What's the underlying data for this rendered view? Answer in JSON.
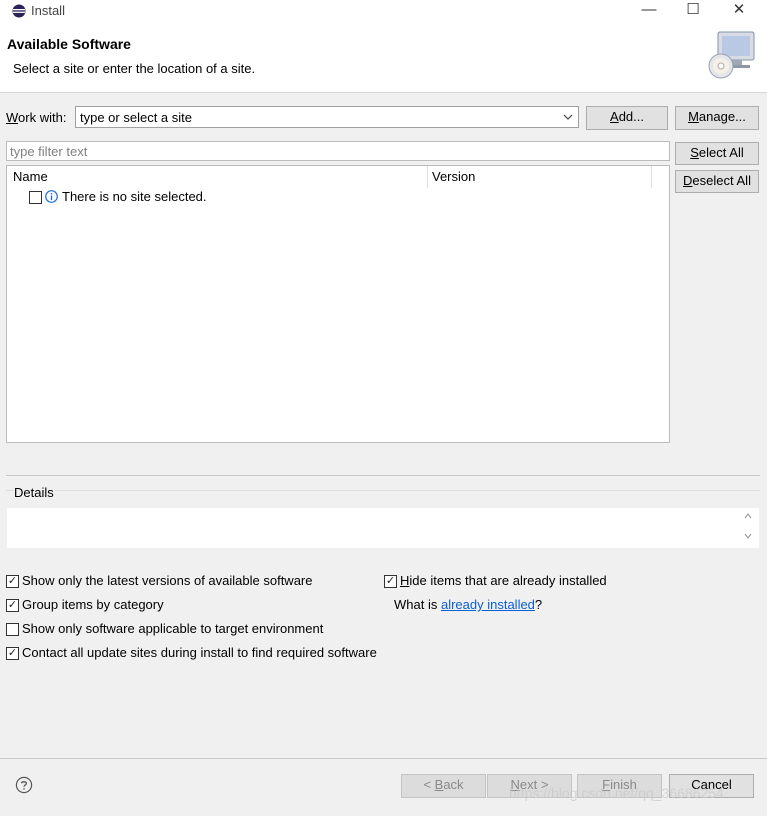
{
  "window": {
    "title": "Install",
    "minimize_glyph": "—",
    "maximize_glyph": "☐",
    "close_glyph": "✕"
  },
  "header": {
    "heading": "Available Software",
    "subtitle": "Select a site or enter the location of a site.",
    "banner_icon": "install-software-icon"
  },
  "work_with": {
    "label_mnemonic": "W",
    "label_rest": "ork with:",
    "value": "type or select a site",
    "add_mnemonic": "A",
    "add_rest": "dd...",
    "manage_mnemonic": "M",
    "manage_rest": "anage..."
  },
  "filter": {
    "placeholder": "type filter text",
    "select_all_mnemonic": "S",
    "select_all_rest": "elect All",
    "deselect_all_mnemonic": "D",
    "deselect_all_rest": "eselect All"
  },
  "tree": {
    "columns": [
      "Name",
      "Version"
    ],
    "row": "There is no site selected."
  },
  "details": {
    "label": "Details"
  },
  "options": {
    "latest_versions": "Show only the latest versions of available software",
    "group_by_category": "Group items by category",
    "target_env": "Show only software applicable to target environment",
    "contact_sites": "Contact all update sites during install to find required software",
    "hide_installed_mnemonic": "H",
    "hide_installed_rest": "ide items that are already installed",
    "what_is_prefix": "What is ",
    "what_is_link": "already installed",
    "what_is_suffix": "?"
  },
  "buttons": {
    "back_prefix": "< ",
    "back_mnemonic": "B",
    "back_rest": "ack",
    "next_mnemonic": "N",
    "next_rest": "ext >",
    "finish_mnemonic": "F",
    "finish_rest": "inish",
    "cancel": "Cancel"
  },
  "watermark": "https://blog.csdn.net/qq_36686254",
  "colors": {
    "link": "#0b5fd4",
    "info": "#1c6fd6"
  }
}
